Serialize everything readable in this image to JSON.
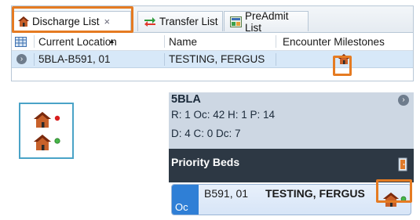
{
  "tabs": [
    {
      "label": "Discharge List",
      "close": "×"
    },
    {
      "label": "Transfer List"
    },
    {
      "label": "PreAdmit List"
    }
  ],
  "grid": {
    "columns": [
      "Current Location",
      "Name",
      "Encounter Milestones"
    ],
    "rows": [
      {
        "location": "5BLA-B591, 01",
        "name": "TESTING, FERGUS"
      }
    ]
  },
  "unit": {
    "name": "5BLA",
    "stats_line1": "R: 1 Oc: 42 H:  1 P: 14",
    "stats_line2": "D: 4 C: 0 Dc: 7",
    "section": "Priority Beds"
  },
  "bed": {
    "status": "Oc",
    "location": "B591, 01",
    "patient": "TESTING, FERGUS"
  },
  "colors": {
    "highlight": "#e57b22",
    "house_roof": "#8b2d10",
    "house_body": "#c8612a",
    "dot_red": "#d81e1e",
    "dot_green": "#46b648",
    "occupied_blue": "#2f7fd6"
  },
  "icons": [
    "house-icon",
    "transfer-arrows-icon",
    "preadmit-icon",
    "grid-select-icon",
    "chevron-right-icon",
    "sort-up-icon"
  ]
}
